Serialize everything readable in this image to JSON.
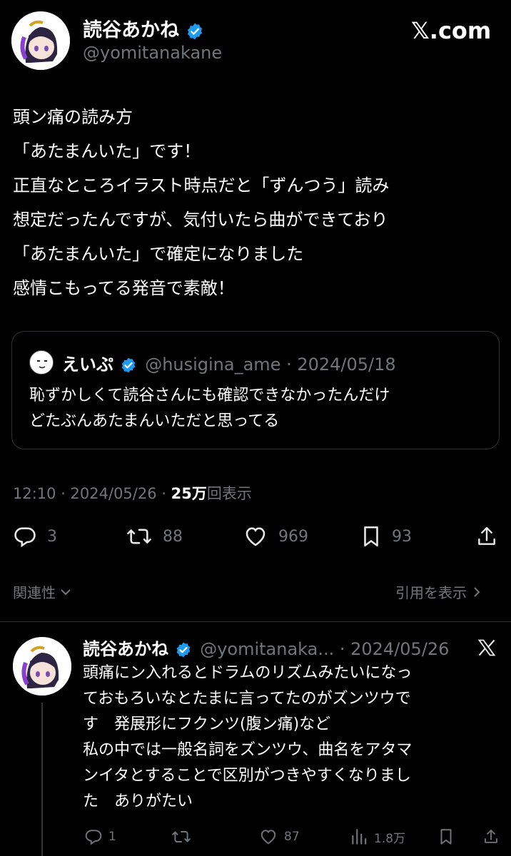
{
  "brand": {
    "logo_text": "𝕏.com"
  },
  "tweet": {
    "author_name": "読谷あかね",
    "handle": "@yomitanakane",
    "lines": [
      "頭ン痛の読み方",
      "「あたまんいた」です！",
      "正直なところイラスト時点だと「ずんつう」読み",
      "想定だったんですが、気付いたら曲ができており",
      "「あたまんいた」で確定になりました",
      "感情こもってる発音で素敵！"
    ],
    "quote": {
      "author_name": "えいぷ",
      "handle_date": "@husigina_ame · 2024/05/18",
      "lines": [
        "恥ずかしくて読谷さんにも確認できなかったんだけ",
        "どたぶんあたまんいただと思ってる"
      ]
    },
    "meta_time": "12:10 · 2024/05/26 · ",
    "meta_views_num": "25万",
    "meta_views_label": "回表示",
    "actions": {
      "replies": "3",
      "retweets": "88",
      "likes": "969",
      "bookmarks": "93"
    }
  },
  "related_label": "関連性",
  "show_quotes_label": "引用を表示",
  "reply": {
    "author_name": "読谷あかね",
    "handle_date": "@yomitanaka... · 2024/05/26",
    "lines": [
      "頭痛にン入れるとドラムのリズムみたいになっ",
      "ておもろいなとたまに言ってたのがズンツウで",
      "す　発展形にフクンツ(腹ン痛)など",
      "私の中では一般名詞をズンツウ、曲名をアタマ",
      "ンイタとすることで区別がつきやすくなりまし",
      "た　ありがたい"
    ],
    "actions": {
      "replies": "1",
      "likes": "87",
      "views": "1.8万"
    }
  },
  "colors": {
    "verified": "#1d9bf0",
    "muted": "#71767b",
    "border": "#2f3336"
  },
  "icons": [
    "verified-icon",
    "x-logo-icon",
    "reply-icon",
    "retweet-icon",
    "like-icon",
    "bookmark-icon",
    "share-icon",
    "views-icon",
    "chevron-down-icon",
    "chevron-right-icon"
  ]
}
